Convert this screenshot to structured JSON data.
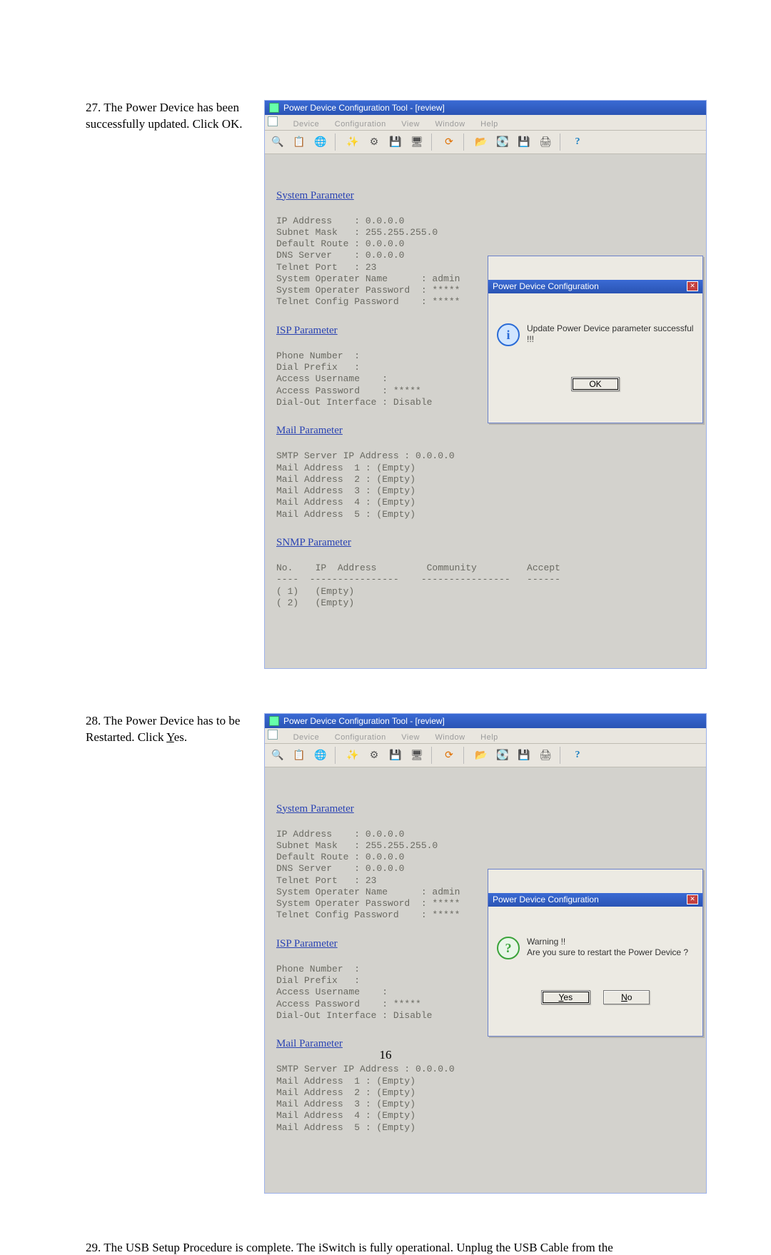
{
  "page_number": "16",
  "steps": {
    "s27": {
      "num": "27.",
      "text_a": "The Power Device has been successfully updated.  Click OK."
    },
    "s28": {
      "num": "28.",
      "text_a": "The Power Device has to be Restarted.",
      "click_label": "Click ",
      "click_yes": "Yes",
      "period": "."
    },
    "s29": "29.  The USB Setup Procedure is complete.  The iSwitch is fully operational.  Unplug the USB Cable from the"
  },
  "app": {
    "title": "Power Device Configuration Tool - [review]",
    "menus": [
      "Device",
      "Configuration",
      "View",
      "Window",
      "Help"
    ],
    "toolbar_icons": [
      "search-icon",
      "list-icon",
      "world-icon",
      "sep",
      "wand-icon",
      "gear2-icon",
      "floppy-icon",
      "monitor-icon",
      "sep",
      "refresh-icon",
      "sep",
      "open-icon",
      "disk-icon",
      "save-icon",
      "printer-icon",
      "sep",
      "help-icon"
    ]
  },
  "sections": {
    "system": {
      "title": "System Parameter",
      "lines": [
        "IP Address    : 0.0.0.0",
        "Subnet Mask   : 255.255.255.0",
        "Default Route : 0.0.0.0",
        "DNS Server    : 0.0.0.0",
        "Telnet Port   : 23",
        "System Operater Name      : admin",
        "System Operater Password  : *****",
        "Telnet Config Password    : *****"
      ]
    },
    "isp": {
      "title": "ISP Parameter",
      "lines": [
        "Phone Number  :",
        "Dial Prefix   :",
        "Access Username    :",
        "Access Password    : *****",
        "Dial-Out Interface : Disable"
      ]
    },
    "mail": {
      "title": "Mail Parameter",
      "lines": [
        "SMTP Server IP Address : 0.0.0.0",
        "Mail Address  1 : (Empty)",
        "Mail Address  2 : (Empty)",
        "Mail Address  3 : (Empty)",
        "Mail Address  4 : (Empty)",
        "Mail Address  5 : (Empty)"
      ]
    },
    "snmp": {
      "title": "SNMP Parameter",
      "lines": [
        "No.    IP  Address         Community         Accept",
        "----  ----------------    ----------------   ------",
        "( 1)   (Empty)",
        "( 2)   (Empty)"
      ]
    }
  },
  "popup27": {
    "title": "Power Device Configuration",
    "message": "Update Power Device parameter successful !!!",
    "ok": "OK"
  },
  "popup28": {
    "title": "Power Device Configuration",
    "heading": "Warning !!",
    "message": "Are you sure to restart the Power Device ?",
    "yes": "Yes",
    "no": "No"
  }
}
